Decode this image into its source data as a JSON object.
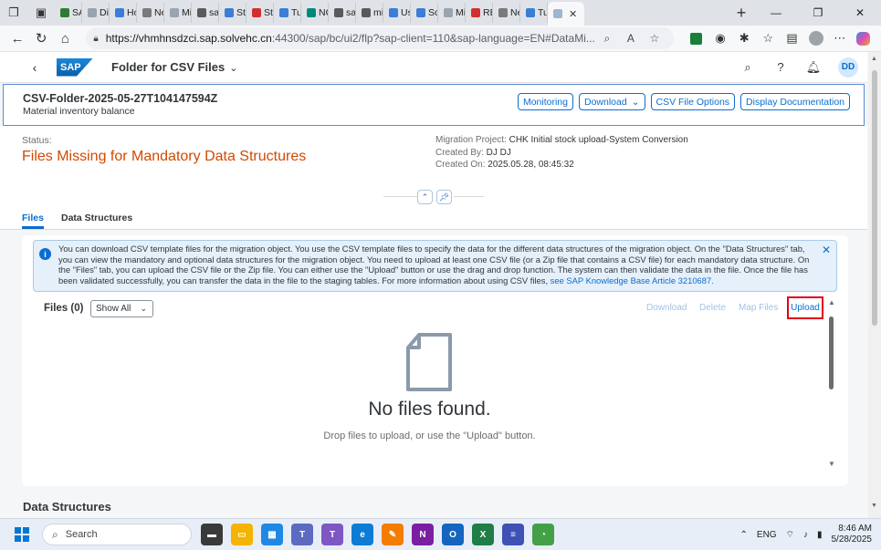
{
  "browser": {
    "tabs": [
      {
        "label": "SA",
        "color": "#2e7d32"
      },
      {
        "label": "Dis",
        "color": "#9aa4ae"
      },
      {
        "label": "Ho",
        "color": "#3b7dd8"
      },
      {
        "label": "Ne",
        "color": "#7a7a7a"
      },
      {
        "label": "Mi",
        "color": "#9aa4ae"
      },
      {
        "label": "sap",
        "color": "#5a5a5a"
      },
      {
        "label": "Ste",
        "color": "#3b7dd8"
      },
      {
        "label": "Ste",
        "color": "#d32f2f"
      },
      {
        "label": "Tu",
        "color": "#3b7dd8"
      },
      {
        "label": "NC",
        "color": "#00897b"
      },
      {
        "label": "saj",
        "color": "#5a5a5a"
      },
      {
        "label": "mi",
        "color": "#5a5a5a"
      },
      {
        "label": "Us",
        "color": "#3b7dd8"
      },
      {
        "label": "So",
        "color": "#3b7dd8"
      },
      {
        "label": "Mi",
        "color": "#9aa4ae"
      },
      {
        "label": "RE",
        "color": "#d32f2f"
      },
      {
        "label": "Ne",
        "color": "#7a7a7a"
      },
      {
        "label": "Tu",
        "color": "#3b7dd8"
      }
    ],
    "active_tab_close": "✕",
    "new_tab": "+",
    "url_host": "https://vhmhnsdzci.sap.solvehc.cn",
    "url_rest": ":44300/sap/bc/ui2/flp?sap-client=110&sap-language=EN#DataMi..."
  },
  "shell": {
    "logo": "SAP",
    "app_title": "Folder for CSV Files",
    "avatar": "DD"
  },
  "header": {
    "title": "CSV-Folder-2025-05-27T104147594Z",
    "subtitle": "Material inventory balance",
    "buttons": {
      "monitoring": "Monitoring",
      "download": "Download",
      "csv_options": "CSV File Options",
      "display_doc": "Display Documentation"
    },
    "status_label": "Status:",
    "status_value": "Files Missing for Mandatory Data Structures",
    "meta": {
      "project_label": "Migration Project:",
      "project_value": "CHK Initial stock upload-System Conversion",
      "created_by_label": "Created By:",
      "created_by_value": "DJ DJ",
      "created_on_label": "Created On:",
      "created_on_value": "2025.05.28, 08:45:32"
    }
  },
  "tabs": {
    "files": "Files",
    "data_structures": "Data Structures"
  },
  "message": {
    "text": "You can download CSV template files for the migration object. You use the CSV template files to specify the data for the different data structures of the migration object. On the \"Data Structures\" tab, you can view the mandatory and optional data structures for the migration object. You need to upload at least one CSV file (or a Zip file that contains a CSV file) for each mandatory data structure. On the \"Files\" tab, you can upload the CSV file or the Zip file. You can either use the \"Upload\" button or use the drag and drop function. The system can then validate the data in the file. Once the file has been validated successfully, you can transfer the data in the file to the staging tables. For more information about using CSV files, ",
    "link": "see SAP Knowledge Base Article 3210687."
  },
  "files_table": {
    "title": "Files (0)",
    "filter": "Show All",
    "download": "Download",
    "delete": "Delete",
    "map_files": "Map Files",
    "upload": "Upload",
    "empty_title": "No files found.",
    "empty_hint": "Drop files to upload, or use the \"Upload\" button."
  },
  "section_data_structures": "Data Structures",
  "taskbar": {
    "search_placeholder": "Search",
    "lang": "ENG",
    "time": "8:46 AM",
    "date": "5/28/2025"
  }
}
